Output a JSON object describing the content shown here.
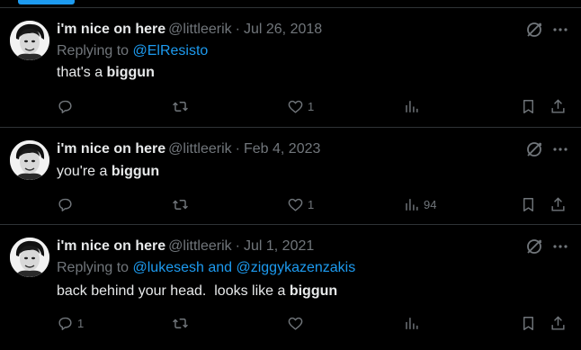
{
  "colors": {
    "background": "#000000",
    "text": "#e7e9ea",
    "muted": "#71767b",
    "accent": "#1d9bf0",
    "divider": "#2f3336"
  },
  "tweets": [
    {
      "display_name": "i'm nice on here",
      "handle": "@littleerik",
      "separator": "·",
      "date": "Jul 26, 2018",
      "reply_prefix": "Replying to ",
      "reply_mentions": "@ElResisto",
      "text_plain": "that's a ",
      "text_bold": "biggun",
      "reply_count": "",
      "repost_count": "",
      "like_count": "1",
      "view_count": ""
    },
    {
      "display_name": "i'm nice on here",
      "handle": "@littleerik",
      "separator": "·",
      "date": "Feb 4, 2023",
      "reply_prefix": "",
      "reply_mentions": "",
      "text_plain": "you're a ",
      "text_bold": "biggun",
      "reply_count": "",
      "repost_count": "",
      "like_count": "1",
      "view_count": "94"
    },
    {
      "display_name": "i'm nice on here",
      "handle": "@littleerik",
      "separator": "·",
      "date": "Jul 1, 2021",
      "reply_prefix": "Replying to ",
      "reply_mentions": "@lukesesh and @ziggykazenzakis",
      "text_plain": "back behind your head.  looks like a ",
      "text_bold": "biggun",
      "reply_count": "1",
      "repost_count": "",
      "like_count": "",
      "view_count": ""
    }
  ],
  "icons": {
    "reply": "reply-bubble-icon",
    "repost": "repost-icon",
    "like": "heart-icon",
    "views": "bar-chart-icon",
    "bookmark": "bookmark-icon",
    "share": "share-icon",
    "grok": "grok-icon",
    "more": "more-dots-icon"
  }
}
